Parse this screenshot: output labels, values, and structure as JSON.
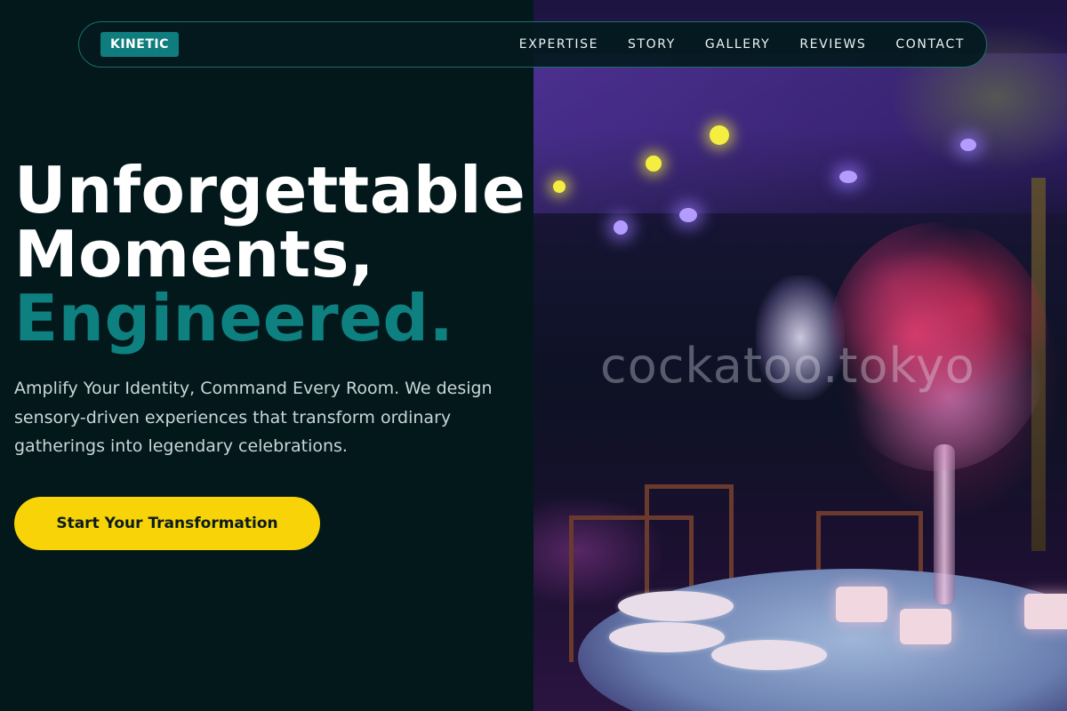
{
  "nav": {
    "logo": "KINETIC",
    "links": [
      "EXPERTISE",
      "STORY",
      "GALLERY",
      "REVIEWS",
      "CONTACT"
    ]
  },
  "hero": {
    "title_line1": "Unforgettable",
    "title_line2": "Moments,",
    "title_accent": "Engineered.",
    "subtitle": "Amplify Your Identity, Command Every Room. We design sensory-driven experiences that transform ordinary gatherings into legendary celebrations.",
    "cta_label": "Start Your Transformation"
  },
  "photo": {
    "watermark": "cockatoo.tokyo"
  },
  "colors": {
    "background": "#02181b",
    "accent": "#0e8080",
    "cta": "#f7d308"
  }
}
